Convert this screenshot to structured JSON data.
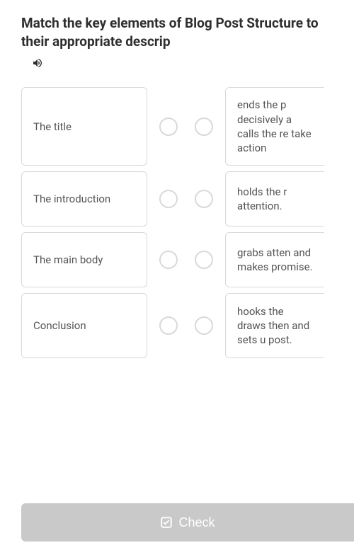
{
  "question": {
    "title": "Match the key elements of Blog Post Structure to their appropriate descrip"
  },
  "left_items": [
    {
      "label": "The title"
    },
    {
      "label": "The introduction"
    },
    {
      "label": "The main body"
    },
    {
      "label": "Conclusion"
    }
  ],
  "right_items": [
    {
      "text": "ends the p decisively a calls the re take action"
    },
    {
      "text": "holds the r attention."
    },
    {
      "text": "grabs atten and makes promise."
    },
    {
      "text": "hooks the draws then and sets u post."
    }
  ],
  "buttons": {
    "check": "Check"
  }
}
